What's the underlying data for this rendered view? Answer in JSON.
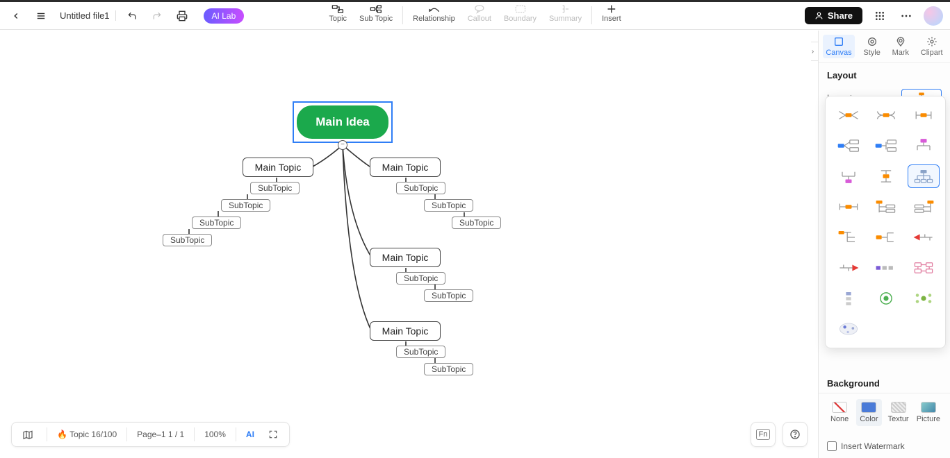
{
  "header": {
    "file_name": "Untitled file1",
    "ai_lab": "AI Lab",
    "share": "Share",
    "center": {
      "topic": "Topic",
      "subtopic": "Sub Topic",
      "relationship": "Relationship",
      "callout": "Callout",
      "boundary": "Boundary",
      "summary": "Summary",
      "insert": "Insert"
    }
  },
  "float_tb": {
    "ai": "AI"
  },
  "mindmap": {
    "main_idea": "Main Idea",
    "topics": [
      {
        "label": "Main Topic"
      },
      {
        "label": "Main Topic"
      },
      {
        "label": "Main Topic"
      },
      {
        "label": "Main Topic"
      }
    ],
    "subtopic_label": "SubTopic"
  },
  "bottom": {
    "topic_count": "Topic 16/100",
    "page": "Page–1  1 / 1",
    "zoom": "100%"
  },
  "rpanel": {
    "tabs": {
      "canvas": "Canvas",
      "style": "Style",
      "mark": "Mark",
      "clipart": "Clipart"
    },
    "layout_title": "Layout",
    "layout_label": "Layout",
    "background_title": "Background",
    "bg": {
      "none": "None",
      "color": "Color",
      "texture": "Textur",
      "picture": "Picture"
    },
    "watermark": "Insert Watermark"
  }
}
